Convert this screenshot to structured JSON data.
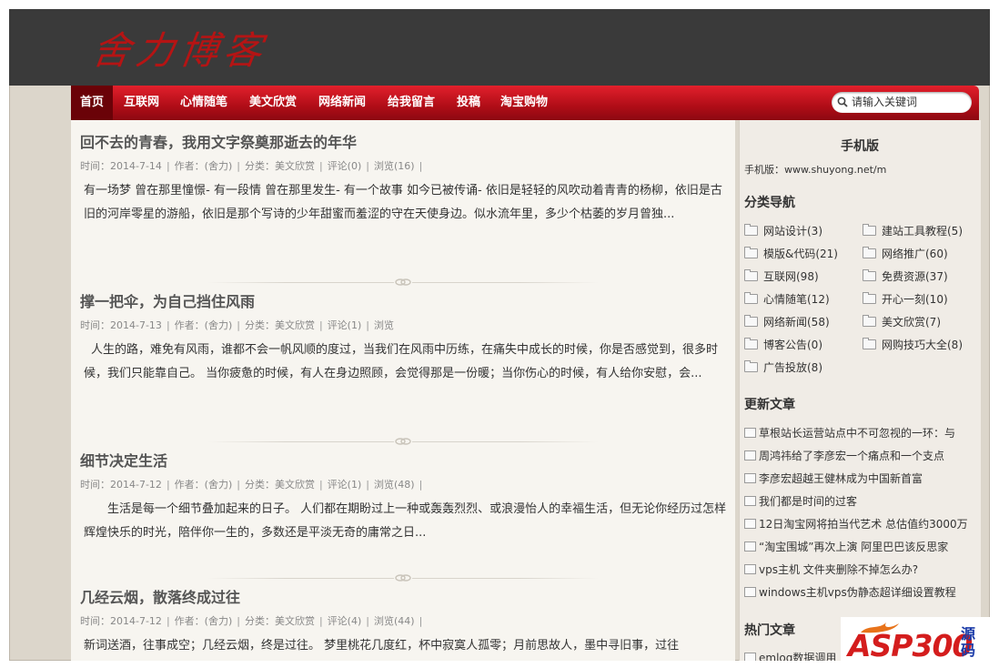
{
  "site": {
    "logo_text": "舍力博客"
  },
  "nav": {
    "items": [
      {
        "label": "首页",
        "active": true
      },
      {
        "label": "互联网"
      },
      {
        "label": "心情随笔"
      },
      {
        "label": "美文欣赏"
      },
      {
        "label": "网络新闻"
      },
      {
        "label": "给我留言"
      },
      {
        "label": "投稿"
      },
      {
        "label": "淘宝购物"
      }
    ],
    "search_placeholder": "请输入关键词"
  },
  "posts": [
    {
      "title": "回不去的青春，我用文字祭奠那逝去的年华",
      "date": "时间：2014-7-14",
      "author": "作者：(舍力)",
      "category": "分类：美文欣赏",
      "comments": "评论(0)",
      "views": "浏览(16)",
      "excerpt": "有一场梦 曾在那里憧憬- 有一段情 曾在那里发生- 有一个故事 如今已被传诵- 依旧是轻轻的风吹动着青青的杨柳，依旧是古旧的河岸零星的游船，依旧是那个写诗的少年甜蜜而羞涩的守在天使身边。似水流年里，多少个枯萎的岁月曾独..."
    },
    {
      "title": "撑一把伞，为自己挡住风雨",
      "date": "时间：2014-7-13",
      "author": "作者：(舍力)",
      "category": "分类：美文欣赏",
      "comments": "评论(1)",
      "views": "浏览",
      "excerpt": "人生的路，难免有风雨，谁都不会一帆风顺的度过，当我们在风雨中历练，在痛失中成长的时候，你是否感觉到，很多时候，我们只能靠自己。    当你疲惫的时候，有人在身边照顾，会觉得那是一份暖；当你伤心的时候，有人给你安慰，会..."
    },
    {
      "title": "细节决定生活",
      "date": "时间：2014-7-12",
      "author": "作者：(舍力)",
      "category": "分类：美文欣赏",
      "comments": "评论(1)",
      "views": "浏览(48)",
      "excerpt": "生活是每一个细节叠加起来的日子。        人们都在期盼过上一种或轰轰烈烈、或浪漫怡人的幸福生活，但无论你经历过怎样辉煌快乐的时光，陪伴你一生的，多数还是平淡无奇的庸常之日..."
    },
    {
      "title": "几经云烟，散落终成过往",
      "date": "时间：2014-7-12",
      "author": "作者：(舍力)",
      "category": "分类：美文欣赏",
      "comments": "评论(4)",
      "views": "浏览(44)",
      "excerpt": "新词送酒，往事成空；几经云烟，终是过往。 梦里桃花几度红，杯中寂寞人孤零；月前思故人，墨中寻旧事，过往"
    }
  ],
  "sidebar": {
    "mobile": {
      "heading": "手机版",
      "text": "手机版：www.shuyong.net/m"
    },
    "categories": {
      "heading": "分类导航",
      "items": [
        "网站设计(3)",
        "建站工具教程(5)",
        "模版&代码(21)",
        "网络推广(60)",
        "互联网(98)",
        "免费资源(37)",
        "心情随笔(12)",
        "开心一刻(10)",
        "网络新闻(58)",
        "美文欣赏(7)",
        "博客公告(0)",
        "网购技巧大全(8)",
        "广告投放(8)"
      ]
    },
    "recent": {
      "heading": "更新文章",
      "items": [
        "草根站长运营站点中不可忽视的一环：与",
        "周鸿祎给了李彦宏一个痛点和一个支点",
        "李彦宏超越王健林成为中国新首富",
        "我们都是时间的过客",
        "12日淘宝网将拍当代艺术 总估值约3000万",
        "“淘宝围城”再次上演 阿里巴巴该反思家",
        "vps主机 文件夹删除不掉怎么办?",
        "windows主机vps伪静态超详细设置教程"
      ]
    },
    "popular": {
      "heading": "热门文章",
      "first_item": "emlog数据调用"
    }
  },
  "watermark": {
    "brand": "ASP300",
    "suffix": "源码"
  },
  "colors": {
    "nav_red": "#c8101c",
    "header_dark": "#3a3a3a",
    "logo_red": "#b51414"
  }
}
